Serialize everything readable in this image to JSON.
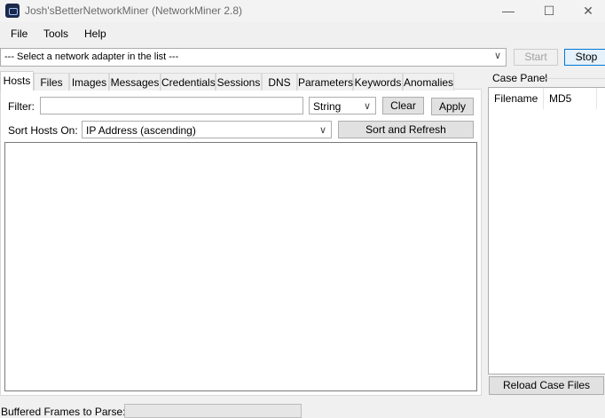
{
  "window": {
    "title": "Josh'sBetterNetworkMiner (NetworkMiner 2.8)",
    "minimize_glyph": "—",
    "maximize_glyph": "☐",
    "close_glyph": "✕"
  },
  "menu": {
    "file": "File",
    "tools": "Tools",
    "help": "Help"
  },
  "adapter": {
    "selected": "--- Select a network adapter in the list ---",
    "start_label": "Start",
    "stop_label": "Stop"
  },
  "tabs": [
    {
      "label": "Hosts",
      "active": true
    },
    {
      "label": "Files"
    },
    {
      "label": "Images"
    },
    {
      "label": "Messages"
    },
    {
      "label": "Credentials"
    },
    {
      "label": "Sessions"
    },
    {
      "label": "DNS"
    },
    {
      "label": "Parameters"
    },
    {
      "label": "Keywords"
    },
    {
      "label": "Anomalies"
    }
  ],
  "hosts": {
    "filter_label": "Filter:",
    "filter_value": "",
    "filter_type": "String",
    "clear_label": "Clear",
    "apply_label": "Apply",
    "sort_label": "Sort Hosts On:",
    "sort_value": "IP Address (ascending)",
    "sort_button": "Sort and Refresh"
  },
  "case_panel": {
    "title": "Case Panel",
    "columns": [
      "Filename",
      "MD5"
    ],
    "reload_label": "Reload Case Files"
  },
  "status": {
    "buffered_label": "Buffered Frames to Parse:"
  },
  "icons": {
    "app": "network-miner-icon",
    "dropdown": "chevron-down-icon"
  }
}
